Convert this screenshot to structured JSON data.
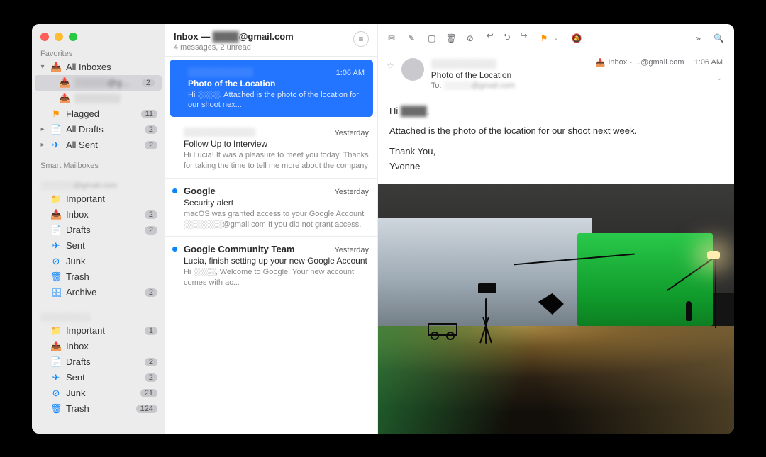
{
  "accountMasked": "@gmail.com",
  "sidebar": {
    "favoritesLabel": "Favorites",
    "smartLabel": "Smart Mailboxes",
    "items": [
      {
        "icon": "inbox-stack-icon",
        "label": "All Inboxes",
        "count": "",
        "level": 0,
        "disc": "v",
        "color": "ic-blue"
      },
      {
        "icon": "inbox-icon",
        "label": "░░░░░@g...",
        "count": "2",
        "level": 1,
        "disc": "",
        "color": "ic-blue",
        "selected": true,
        "blurLabel": true
      },
      {
        "icon": "inbox-icon",
        "label": "░░░░░░░",
        "count": "",
        "level": 1,
        "disc": "",
        "color": "ic-blue",
        "blurLabel": true
      },
      {
        "icon": "flag-icon",
        "label": "Flagged",
        "count": "11",
        "level": 0,
        "disc": "",
        "color": "ic-orange"
      },
      {
        "icon": "doc-icon",
        "label": "All Drafts",
        "count": "2",
        "level": 0,
        "disc": ">",
        "color": "ic-blue"
      },
      {
        "icon": "sent-icon",
        "label": "All Sent",
        "count": "2",
        "level": 0,
        "disc": ">",
        "color": "ic-blue"
      }
    ],
    "accountSectionLabel": "░░░░░░@gmail.com",
    "acct": [
      {
        "icon": "folder-icon",
        "label": "Important",
        "count": "",
        "color": "ic-blue"
      },
      {
        "icon": "inbox-icon",
        "label": "Inbox",
        "count": "2",
        "color": "ic-blue"
      },
      {
        "icon": "doc-icon",
        "label": "Drafts",
        "count": "2",
        "color": "ic-blue"
      },
      {
        "icon": "sent-icon",
        "label": "Sent",
        "count": "",
        "color": "ic-blue"
      },
      {
        "icon": "junk-icon",
        "label": "Junk",
        "count": "",
        "color": "ic-blue"
      },
      {
        "icon": "trash-icon",
        "label": "Trash",
        "count": "",
        "color": "ic-blue"
      },
      {
        "icon": "archive-icon",
        "label": "Archive",
        "count": "2",
        "color": "ic-blue"
      }
    ],
    "acct2Label": "░░░░░░░░░",
    "acct2": [
      {
        "icon": "folder-icon",
        "label": "Important",
        "count": "1",
        "color": "ic-blue"
      },
      {
        "icon": "inbox-icon",
        "label": "Inbox",
        "count": "",
        "color": "ic-blue"
      },
      {
        "icon": "doc-icon",
        "label": "Drafts",
        "count": "2",
        "color": "ic-blue"
      },
      {
        "icon": "sent-icon",
        "label": "Sent",
        "count": "2",
        "color": "ic-blue"
      },
      {
        "icon": "junk-icon",
        "label": "Junk",
        "count": "21",
        "color": "ic-blue"
      },
      {
        "icon": "trash-icon",
        "label": "Trash",
        "count": "124",
        "color": "ic-blue"
      }
    ]
  },
  "listHeader": {
    "titlePrefix": "Inbox — ",
    "accountSuffix": "@gmail.com",
    "subtitle": "4 messages, 2 unread"
  },
  "messages": [
    {
      "from": "░░░░░░░░░░",
      "time": "1:06 AM",
      "subject": "Photo of the Location",
      "preview": "Hi ░░░░, Attached is the photo of the location for our shoot nex...",
      "unread": false,
      "selected": true,
      "blurFrom": true
    },
    {
      "from": "░░░░░░░░░░░",
      "time": "Yesterday",
      "subject": "Follow Up to Interview",
      "preview": "Hi Lucia! It was a pleasure to meet you today. Thanks for taking the time to tell me more about the company and the position. I...",
      "unread": false,
      "blurFrom": true
    },
    {
      "from": "Google",
      "time": "Yesterday",
      "subject": "Security alert",
      "preview": "macOS was granted access to your Google Account ░░░░░░░@gmail.com If you did not grant access, you should c...",
      "unread": true
    },
    {
      "from": "Google Community Team",
      "time": "Yesterday",
      "subject": "Lucia, finish setting up your new Google Account",
      "preview": "Hi ░░░░, Welcome to Google. Your new account comes with ac...",
      "unread": true
    }
  ],
  "reader": {
    "from": "░░░░░░░░░░",
    "subject": "Photo of the Location",
    "toPrefix": "To: ",
    "toAddr": "░░░░░@gmail.com",
    "mailboxLabel": "Inbox - ...@gmail.com",
    "time": "1:06 AM",
    "body": {
      "greeting": "Hi ░░░░,",
      "line1": "Attached is the photo of the location for our shoot next week.",
      "thanks": "Thank You,",
      "signature": "Yvonne"
    }
  },
  "icons": {
    "envelope": "✉︎",
    "compose": "✎",
    "archive": "▢",
    "trash": "🗑",
    "junkIn": "⊘",
    "reply": "↩︎",
    "replyAll": "⮌",
    "forward": "↪︎",
    "flag": "⚑",
    "mute": "🔕",
    "more": "»",
    "search": "🔍",
    "inboxTag": "📥"
  }
}
